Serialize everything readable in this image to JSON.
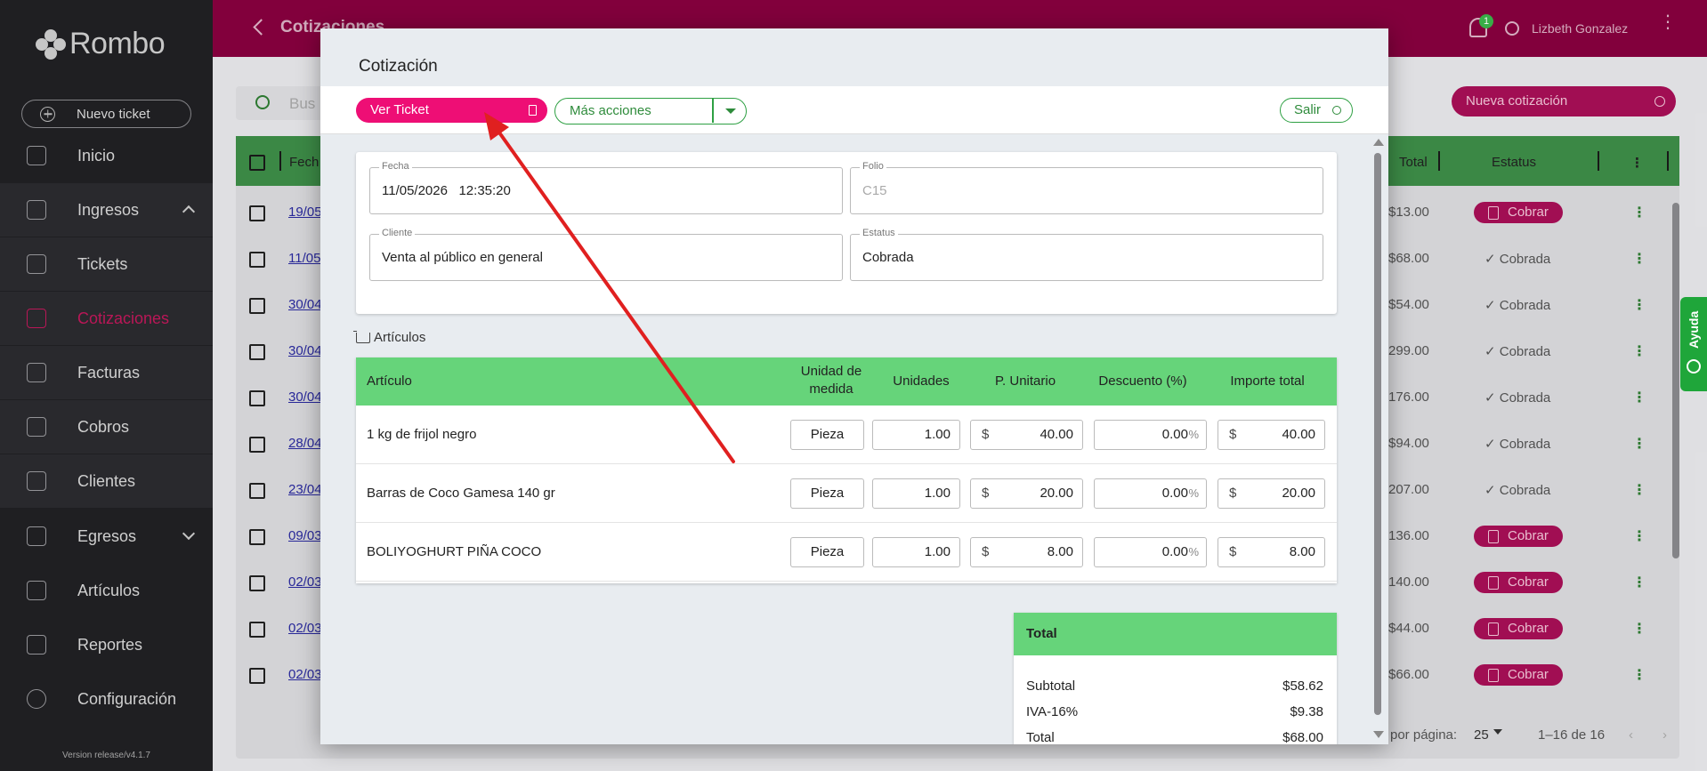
{
  "sidebar": {
    "logo": "Rombo",
    "new_ticket": "Nuevo ticket",
    "items": [
      {
        "label": "Inicio",
        "icon": "home-icon"
      },
      {
        "label": "Ingresos",
        "icon": "income-icon"
      },
      {
        "label": "Tickets",
        "icon": "ticket-icon"
      },
      {
        "label": "Cotizaciones",
        "icon": "quote-icon"
      },
      {
        "label": "Facturas",
        "icon": "invoice-icon"
      },
      {
        "label": "Cobros",
        "icon": "payments-icon"
      },
      {
        "label": "Clientes",
        "icon": "clients-icon"
      },
      {
        "label": "Egresos",
        "icon": "expenses-icon"
      },
      {
        "label": "Artículos",
        "icon": "tag-icon"
      },
      {
        "label": "Reportes",
        "icon": "reports-icon"
      },
      {
        "label": "Configuración",
        "icon": "gear-icon"
      }
    ],
    "version": "Version release/v4.1.7"
  },
  "topbar": {
    "title": "Cotizaciones",
    "notifications": "1",
    "user": "Lizbeth Gonzalez"
  },
  "background": {
    "search_placeholder": "Bus",
    "new_quote": "Nueva cotización",
    "headers": {
      "fecha": "Fech",
      "total": "Total",
      "estatus": "Estatus"
    },
    "rows": [
      {
        "date": "19/05",
        "total": "$13.00",
        "status": "Cobrar"
      },
      {
        "date": "11/05",
        "total": "$68.00",
        "status": "✓ Cobrada"
      },
      {
        "date": "30/04",
        "total": "$54.00",
        "status": "✓ Cobrada"
      },
      {
        "date": "30/04",
        "total": "299.00",
        "status": "✓ Cobrada"
      },
      {
        "date": "30/04",
        "total": "176.00",
        "status": "✓ Cobrada"
      },
      {
        "date": "28/04",
        "total": "$94.00",
        "status": "✓ Cobrada"
      },
      {
        "date": "23/04",
        "total": "207.00",
        "status": "✓ Cobrada"
      },
      {
        "date": "09/03",
        "total": "136.00",
        "status": "Cobrar"
      },
      {
        "date": "02/03",
        "total": "140.00",
        "status": "Cobrar"
      },
      {
        "date": "02/03",
        "total": "$44.00",
        "status": "Cobrar"
      },
      {
        "date": "02/03",
        "total": "$66.00",
        "status": "Cobrar"
      }
    ],
    "footer": {
      "per_page_label": "por página:",
      "per_page": "25",
      "range": "1–16 de 16"
    }
  },
  "help": "Ayuda",
  "modal": {
    "title": "Cotización",
    "ver_ticket": "Ver Ticket",
    "mas_acciones": "Más acciones",
    "salir": "Salir",
    "fields": {
      "fecha_label": "Fecha",
      "fecha_value": "11/05/2026   12:35:20",
      "folio_label": "Folio",
      "folio_value": "C15",
      "cliente_label": "Cliente",
      "cliente_value": "Venta al público en general",
      "estatus_label": "Estatus",
      "estatus_value": "Cobrada"
    },
    "articles_title": "Artículos",
    "columns": {
      "articulo": "Artículo",
      "unidad": "Unidad de medida",
      "unidades": "Unidades",
      "unitario": "P. Unitario",
      "descuento": "Descuento (%)",
      "importe": "Importe total"
    },
    "items": [
      {
        "name": "1 kg de frijol negro",
        "unit": "Pieza",
        "qty": "1.00",
        "price": "40.00",
        "discount": "0.00",
        "total": "40.00"
      },
      {
        "name": "Barras de Coco Gamesa 140 gr",
        "unit": "Pieza",
        "qty": "1.00",
        "price": "20.00",
        "discount": "0.00",
        "total": "20.00"
      },
      {
        "name": "BOLIYOGHURT PIÑA COCO",
        "unit": "Pieza",
        "qty": "1.00",
        "price": "8.00",
        "discount": "0.00",
        "total": "8.00"
      }
    ],
    "currency": "$",
    "percent": "%",
    "totals": {
      "title": "Total",
      "subtotal_label": "Subtotal",
      "subtotal": "$58.62",
      "iva_label": "IVA-16%",
      "iva": "$9.38",
      "total_label": "Total",
      "total": "$68.00"
    }
  },
  "colors": {
    "brand": "#88003f",
    "accent_pink": "#ee0e75",
    "green": "#66d47a",
    "arrow": "#e02020"
  }
}
